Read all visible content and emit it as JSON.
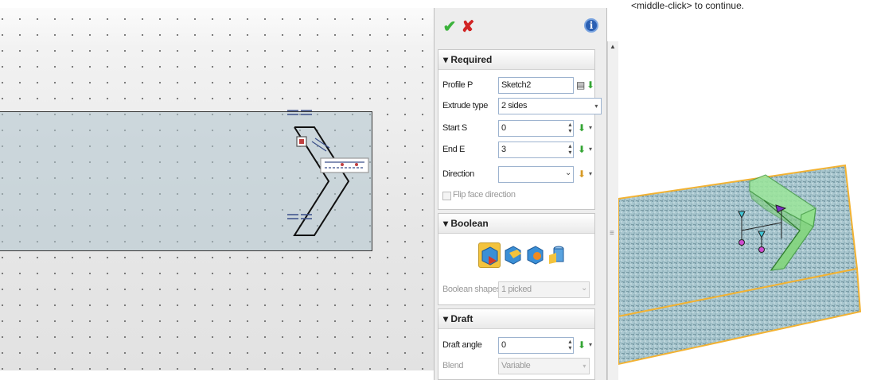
{
  "status_hint": "<middle-click> to continue.",
  "panel": {
    "ok_icon": "checkmark-icon",
    "cancel_icon": "x-icon",
    "info_icon": "info-icon",
    "info_glyph": "i",
    "ok_glyph": "✔",
    "cancel_glyph": "✘",
    "required": {
      "title": "▾ Required",
      "profile_label": "Profile P",
      "profile_value": "Sketch2",
      "extrude_type_label": "Extrude type",
      "extrude_type_value": "2 sides",
      "start_label": "Start S",
      "start_value": "0",
      "end_label": "End E",
      "end_value": "3",
      "direction_label": "Direction",
      "direction_value": "",
      "flip_label": "Flip face direction"
    },
    "boolean": {
      "title": "▾ Boolean",
      "shapes_label": "Boolean shapes",
      "shapes_value": "1 picked"
    },
    "draft": {
      "title": "▾ Draft",
      "angle_label": "Draft angle",
      "angle_value": "0",
      "blend_label": "Blend",
      "blend_value": "Variable"
    }
  },
  "colors": {
    "accent_green": "#34a534",
    "cancel_red": "#d12424",
    "edge_orange": "#f2b233",
    "extrude_green": "#8fe08a"
  }
}
